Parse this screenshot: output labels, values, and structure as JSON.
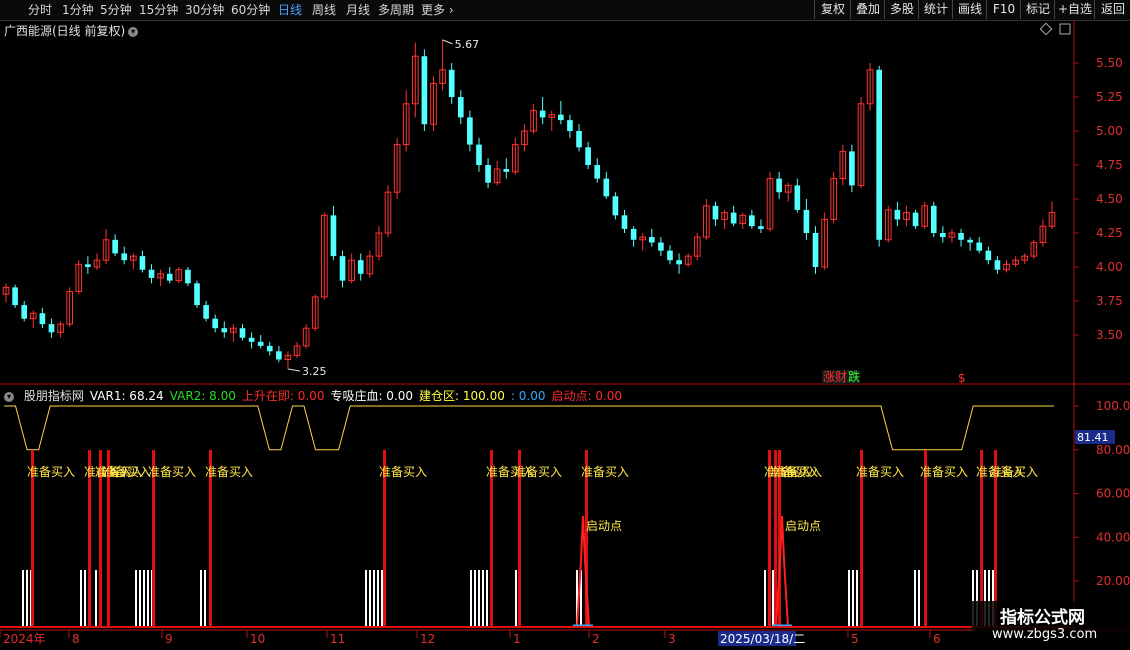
{
  "toolbar": {
    "tabs": [
      {
        "label": "分时",
        "active": false
      },
      {
        "label": "1分钟",
        "active": false
      },
      {
        "label": "5分钟",
        "active": false
      },
      {
        "label": "15分钟",
        "active": false
      },
      {
        "label": "30分钟",
        "active": false
      },
      {
        "label": "60分钟",
        "active": false
      },
      {
        "label": "日线",
        "active": true
      },
      {
        "label": "周线",
        "active": false
      },
      {
        "label": "月线",
        "active": false
      },
      {
        "label": "多周期",
        "active": false
      },
      {
        "label": "更多",
        "active": false
      }
    ],
    "right_buttons": [
      "复权",
      "叠加",
      "多股",
      "统计",
      "画线",
      "F10",
      "标记",
      "+自选",
      "返回"
    ]
  },
  "stock": {
    "title": "广西能源(日线 前复权)",
    "high_label": "5.67",
    "low_label": "3.25",
    "event_zhangcai": "涨财",
    "event_die": "跌",
    "event_dollar": "$"
  },
  "price_axis": {
    "ticks": [
      5.5,
      5.25,
      5.0,
      4.75,
      4.5,
      4.25,
      4.0,
      3.75,
      3.5
    ]
  },
  "indicator": {
    "name": "股朋指标网",
    "items": [
      {
        "label": "VAR1: 68.24",
        "color": "#ffffff"
      },
      {
        "label": "VAR2: 8.00",
        "color": "#22dd22"
      },
      {
        "label": "上升在即: 0.00",
        "color": "#ff2a2a"
      },
      {
        "label": "专吸庄血: 0.00",
        "color": "#ffffff"
      },
      {
        "label": "建仓区: 100.00",
        "color": "#ffff44"
      },
      {
        "label": ": 0.00",
        "color": "#33aaff"
      },
      {
        "label": "启动点: 0.00",
        "color": "#ff2a2a"
      }
    ],
    "axis_ticks": [
      100.0,
      80.0,
      60.0,
      40.0,
      20.0
    ],
    "current_value": "81.41",
    "buy_label": "准备买入",
    "start_label": "启动点"
  },
  "time_axis": {
    "labels": [
      "2024年",
      "8",
      "9",
      "10",
      "11",
      "12",
      "1",
      "2",
      "3",
      "2025/03/18/二",
      "5",
      "6"
    ]
  },
  "watermark": {
    "line1": "指标公式网",
    "line2": "www.zbgs3.com"
  },
  "chart_data": {
    "type": "candlestick",
    "price_range": [
      3.25,
      5.67
    ],
    "ohlc": [
      [
        3.8,
        3.88,
        3.74,
        3.85
      ],
      [
        3.85,
        3.87,
        3.7,
        3.72
      ],
      [
        3.72,
        3.75,
        3.6,
        3.62
      ],
      [
        3.62,
        3.68,
        3.55,
        3.66
      ],
      [
        3.66,
        3.7,
        3.55,
        3.58
      ],
      [
        3.58,
        3.62,
        3.48,
        3.52
      ],
      [
        3.52,
        3.6,
        3.48,
        3.58
      ],
      [
        3.58,
        3.85,
        3.56,
        3.82
      ],
      [
        3.82,
        4.05,
        3.8,
        4.02
      ],
      [
        4.02,
        4.08,
        3.95,
        4.0
      ],
      [
        4.0,
        4.1,
        3.98,
        4.05
      ],
      [
        4.05,
        4.28,
        4.02,
        4.2
      ],
      [
        4.2,
        4.24,
        4.08,
        4.1
      ],
      [
        4.1,
        4.15,
        4.02,
        4.05
      ],
      [
        4.05,
        4.1,
        3.98,
        4.08
      ],
      [
        4.08,
        4.12,
        3.96,
        3.98
      ],
      [
        3.98,
        4.02,
        3.88,
        3.92
      ],
      [
        3.92,
        3.98,
        3.86,
        3.95
      ],
      [
        3.95,
        4.0,
        3.88,
        3.9
      ],
      [
        3.9,
        4.0,
        3.88,
        3.98
      ],
      [
        3.98,
        4.0,
        3.86,
        3.88
      ],
      [
        3.88,
        3.9,
        3.7,
        3.72
      ],
      [
        3.72,
        3.75,
        3.6,
        3.62
      ],
      [
        3.62,
        3.65,
        3.52,
        3.55
      ],
      [
        3.55,
        3.6,
        3.48,
        3.52
      ],
      [
        3.52,
        3.58,
        3.45,
        3.55
      ],
      [
        3.55,
        3.58,
        3.46,
        3.48
      ],
      [
        3.48,
        3.52,
        3.4,
        3.45
      ],
      [
        3.45,
        3.5,
        3.4,
        3.42
      ],
      [
        3.42,
        3.45,
        3.35,
        3.38
      ],
      [
        3.38,
        3.42,
        3.3,
        3.32
      ],
      [
        3.32,
        3.38,
        3.25,
        3.35
      ],
      [
        3.35,
        3.45,
        3.33,
        3.42
      ],
      [
        3.42,
        3.58,
        3.4,
        3.55
      ],
      [
        3.55,
        3.8,
        3.53,
        3.78
      ],
      [
        3.78,
        4.4,
        3.76,
        4.38
      ],
      [
        4.38,
        4.45,
        4.05,
        4.08
      ],
      [
        4.08,
        4.12,
        3.85,
        3.9
      ],
      [
        3.9,
        4.1,
        3.88,
        4.05
      ],
      [
        4.05,
        4.1,
        3.9,
        3.95
      ],
      [
        3.95,
        4.12,
        3.92,
        4.08
      ],
      [
        4.08,
        4.3,
        4.05,
        4.25
      ],
      [
        4.25,
        4.6,
        4.22,
        4.55
      ],
      [
        4.55,
        4.95,
        4.5,
        4.9
      ],
      [
        4.9,
        5.3,
        4.85,
        5.2
      ],
      [
        5.2,
        5.65,
        5.1,
        5.55
      ],
      [
        5.55,
        5.6,
        5.0,
        5.05
      ],
      [
        5.05,
        5.4,
        5.0,
        5.35
      ],
      [
        5.35,
        5.67,
        5.3,
        5.45
      ],
      [
        5.45,
        5.5,
        5.2,
        5.25
      ],
      [
        5.25,
        5.3,
        5.05,
        5.1
      ],
      [
        5.1,
        5.15,
        4.85,
        4.9
      ],
      [
        4.9,
        4.95,
        4.7,
        4.75
      ],
      [
        4.75,
        4.8,
        4.58,
        4.62
      ],
      [
        4.62,
        4.78,
        4.6,
        4.72
      ],
      [
        4.72,
        4.8,
        4.65,
        4.7
      ],
      [
        4.7,
        4.95,
        4.68,
        4.9
      ],
      [
        4.9,
        5.05,
        4.85,
        5.0
      ],
      [
        5.0,
        5.2,
        4.98,
        5.15
      ],
      [
        5.15,
        5.25,
        5.05,
        5.1
      ],
      [
        5.1,
        5.15,
        5.0,
        5.12
      ],
      [
        5.12,
        5.22,
        5.05,
        5.08
      ],
      [
        5.08,
        5.12,
        4.95,
        5.0
      ],
      [
        5.0,
        5.05,
        4.85,
        4.88
      ],
      [
        4.88,
        4.92,
        4.72,
        4.75
      ],
      [
        4.75,
        4.8,
        4.62,
        4.65
      ],
      [
        4.65,
        4.7,
        4.5,
        4.52
      ],
      [
        4.52,
        4.55,
        4.35,
        4.38
      ],
      [
        4.38,
        4.42,
        4.25,
        4.28
      ],
      [
        4.28,
        4.3,
        4.15,
        4.2
      ],
      [
        4.2,
        4.25,
        4.12,
        4.22
      ],
      [
        4.22,
        4.28,
        4.15,
        4.18
      ],
      [
        4.18,
        4.22,
        4.08,
        4.12
      ],
      [
        4.12,
        4.16,
        4.02,
        4.05
      ],
      [
        4.05,
        4.1,
        3.95,
        4.02
      ],
      [
        4.02,
        4.1,
        4.0,
        4.08
      ],
      [
        4.08,
        4.25,
        4.05,
        4.22
      ],
      [
        4.22,
        4.5,
        4.2,
        4.45
      ],
      [
        4.45,
        4.48,
        4.3,
        4.35
      ],
      [
        4.35,
        4.42,
        4.28,
        4.4
      ],
      [
        4.4,
        4.45,
        4.3,
        4.32
      ],
      [
        4.32,
        4.4,
        4.28,
        4.38
      ],
      [
        4.38,
        4.42,
        4.28,
        4.3
      ],
      [
        4.3,
        4.35,
        4.25,
        4.28
      ],
      [
        4.28,
        4.7,
        4.26,
        4.65
      ],
      [
        4.65,
        4.7,
        4.5,
        4.55
      ],
      [
        4.55,
        4.62,
        4.48,
        4.6
      ],
      [
        4.6,
        4.65,
        4.4,
        4.42
      ],
      [
        4.42,
        4.5,
        4.2,
        4.25
      ],
      [
        4.25,
        4.3,
        3.95,
        4.0
      ],
      [
        4.0,
        4.4,
        3.98,
        4.35
      ],
      [
        4.35,
        4.7,
        4.32,
        4.65
      ],
      [
        4.65,
        4.9,
        4.6,
        4.85
      ],
      [
        4.85,
        4.9,
        4.55,
        4.6
      ],
      [
        4.6,
        5.25,
        4.58,
        5.2
      ],
      [
        5.2,
        5.5,
        5.15,
        5.45
      ],
      [
        5.45,
        5.48,
        4.15,
        4.2
      ],
      [
        4.2,
        4.45,
        4.18,
        4.42
      ],
      [
        4.42,
        4.48,
        4.3,
        4.35
      ],
      [
        4.35,
        4.45,
        4.3,
        4.4
      ],
      [
        4.4,
        4.42,
        4.28,
        4.3
      ],
      [
        4.3,
        4.48,
        4.28,
        4.45
      ],
      [
        4.45,
        4.48,
        4.22,
        4.25
      ],
      [
        4.25,
        4.3,
        4.18,
        4.22
      ],
      [
        4.22,
        4.28,
        4.18,
        4.25
      ],
      [
        4.25,
        4.28,
        4.15,
        4.2
      ],
      [
        4.2,
        4.22,
        4.12,
        4.18
      ],
      [
        4.18,
        4.22,
        4.1,
        4.12
      ],
      [
        4.12,
        4.15,
        4.02,
        4.05
      ],
      [
        4.05,
        4.08,
        3.95,
        3.98
      ],
      [
        3.98,
        4.05,
        3.96,
        4.02
      ],
      [
        4.02,
        4.08,
        4.0,
        4.05
      ],
      [
        4.05,
        4.1,
        4.02,
        4.08
      ],
      [
        4.08,
        4.2,
        4.06,
        4.18
      ],
      [
        4.18,
        4.35,
        4.15,
        4.3
      ],
      [
        4.3,
        4.48,
        4.28,
        4.4
      ]
    ],
    "ind_line": [
      100,
      100,
      80,
      80,
      100,
      100,
      100,
      100,
      100,
      100,
      100,
      100,
      100,
      100,
      100,
      100,
      100,
      100,
      100,
      100,
      100,
      100,
      100,
      80,
      80,
      100,
      100,
      80,
      80,
      80,
      100,
      100,
      100,
      100,
      100,
      100,
      100,
      100,
      100,
      100,
      100,
      100,
      100,
      100,
      100,
      100,
      100,
      100,
      100,
      100,
      100,
      100,
      100,
      100,
      100,
      100,
      100,
      100,
      100,
      100,
      100,
      100,
      100,
      100,
      100,
      100,
      100,
      100,
      100,
      100,
      100,
      100,
      100,
      100,
      100,
      100,
      100,
      80,
      80,
      80,
      80,
      80,
      80,
      80,
      100,
      100,
      100,
      100,
      100,
      100,
      100,
      100
    ],
    "buy_signals_x": [
      31,
      88,
      99,
      107,
      152,
      209,
      383,
      490,
      518,
      585,
      768,
      774,
      778,
      860,
      924,
      980,
      994
    ],
    "start_points_x": [
      583,
      782
    ]
  }
}
